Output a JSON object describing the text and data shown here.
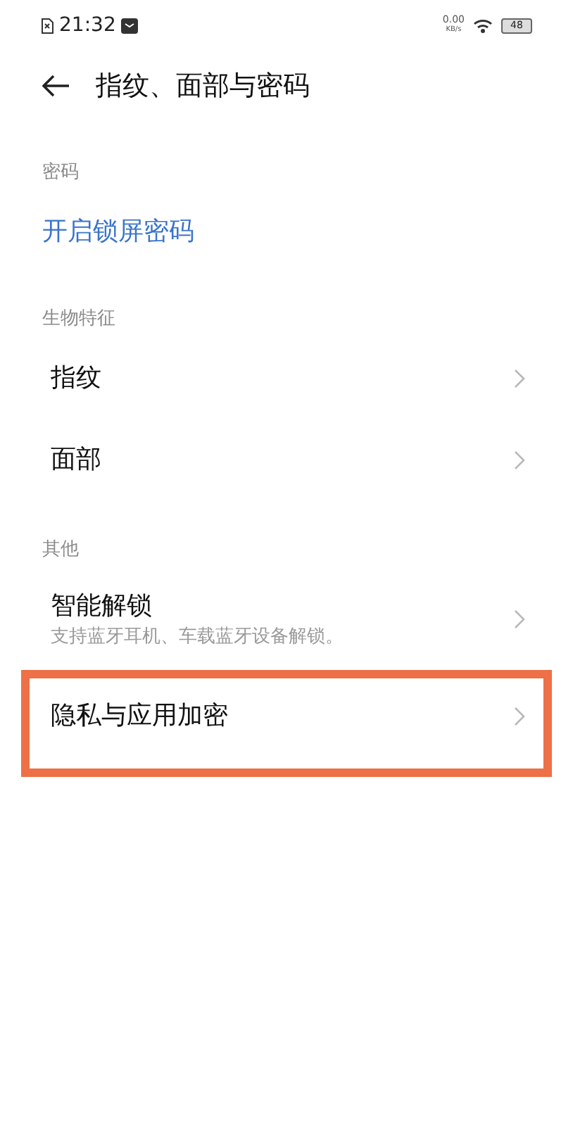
{
  "status_bar": {
    "time": "21:32",
    "speed": "0.00",
    "speed_unit": "KB/s",
    "battery": "48"
  },
  "header": {
    "title": "指纹、面部与密码"
  },
  "sections": [
    {
      "title": "密码",
      "items": [
        {
          "kind": "link",
          "title": "开启锁屏密码"
        }
      ]
    },
    {
      "title": "生物特征",
      "items": [
        {
          "kind": "nav",
          "title": "指纹"
        },
        {
          "kind": "nav",
          "title": "面部"
        }
      ]
    },
    {
      "title": "其他",
      "items": [
        {
          "kind": "nav",
          "title": "智能解锁",
          "subtitle": "支持蓝牙耳机、车载蓝牙设备解锁。"
        },
        {
          "kind": "nav",
          "title": "隐私与应用加密",
          "highlighted": true
        }
      ]
    }
  ]
}
